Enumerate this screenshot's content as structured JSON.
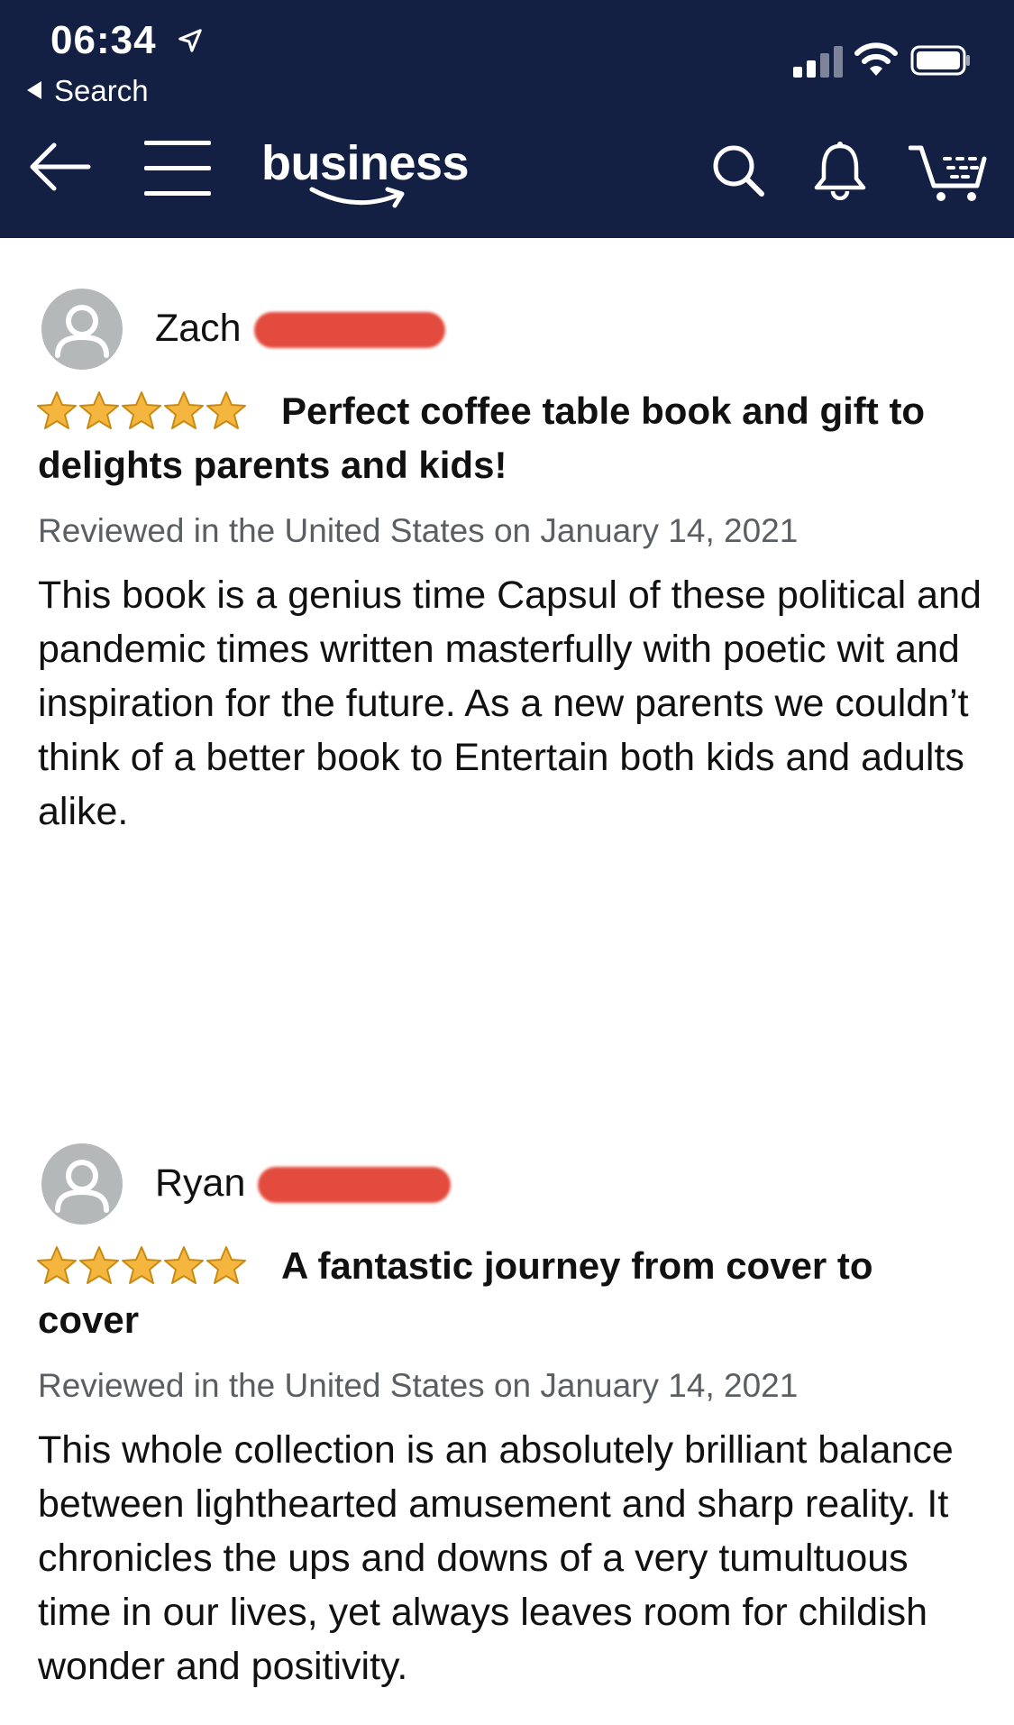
{
  "status_bar": {
    "time": "06:34",
    "back_app_label": "Search",
    "location_icon": "location-arrow-icon",
    "signal_icon": "cellular-signal-icon",
    "wifi_icon": "wifi-icon",
    "battery_icon": "battery-icon"
  },
  "nav": {
    "brand_label": "business",
    "back_icon": "back-arrow-icon",
    "menu_icon": "hamburger-menu-icon",
    "search_icon": "search-icon",
    "bell_icon": "notification-bell-icon",
    "cart_icon": "cart-icon",
    "background_color": "#132043"
  },
  "reviews": [
    {
      "reviewer_name": "Zach",
      "name_redacted": true,
      "rating": 5,
      "title": "Perfect coffee table book and gift to delights parents and kids!",
      "meta": "Reviewed in the United States on January 14, 2021",
      "body": "This book is a genius time Capsul of these political and pandemic times written masterfully with poetic wit and inspiration for the future. As a new parents we couldn’t think of a better book to Entertain both kids and adults alike."
    },
    {
      "reviewer_name": "Ryan",
      "name_redacted": true,
      "rating": 5,
      "title": "A fantastic journey from cover to cover",
      "meta": "Reviewed in the United States on January 14, 2021",
      "body": "This whole collection is an absolutely brilliant balance between lighthearted amusement and sharp reality. It chronicles the ups and downs of a very tumultuous time in our lives, yet always leaves room for childish wonder and positivity."
    }
  ],
  "colors": {
    "star_fill": "#f4b63f",
    "star_outline": "#c98a12",
    "redaction": "#e24b3d",
    "meta_text": "#5b5f63"
  }
}
